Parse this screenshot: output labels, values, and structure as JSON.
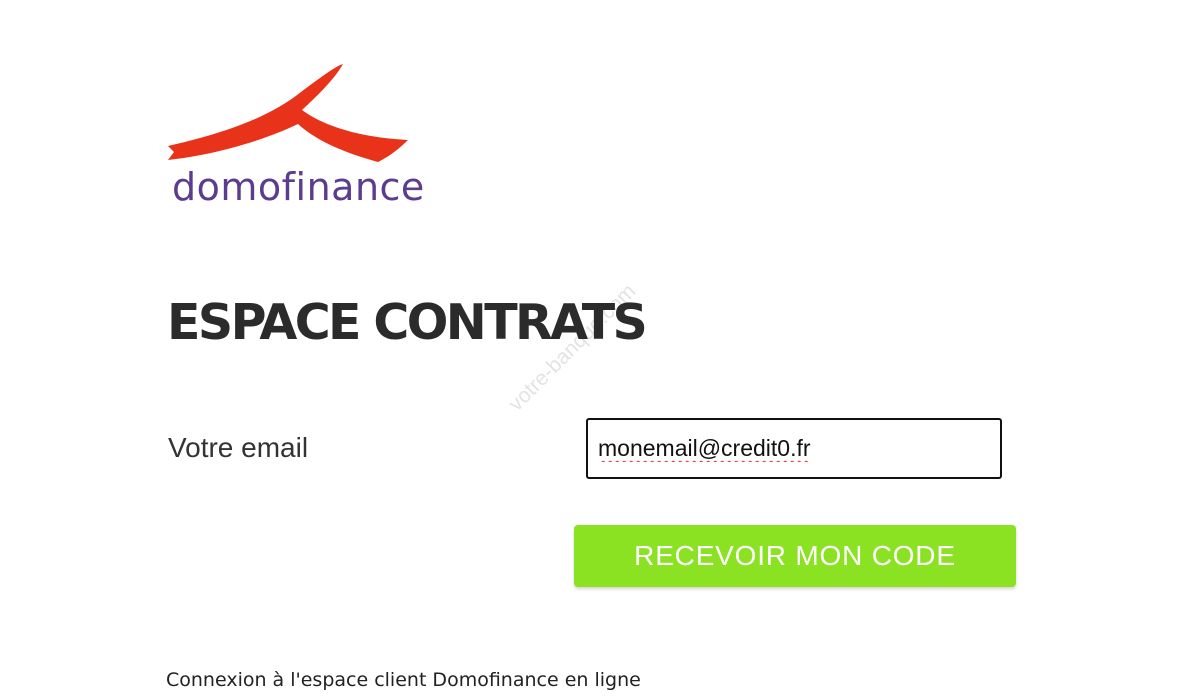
{
  "brand": {
    "name": "domofinance",
    "logo_icon": "domofinance-swoosh-logo",
    "swoosh_color": "#e8321a",
    "wordmark_color": "#5b3c8f"
  },
  "watermark": "votre-banque.com",
  "page_title": "ESPACE CONTRATS",
  "form": {
    "email_label": "Votre email",
    "email_value": "monemail@credit0.fr",
    "submit_label": "RECEVOIR MON CODE",
    "submit_color": "#8be223"
  },
  "footer_text": "Connexion à l'espace client Domofinance en ligne"
}
